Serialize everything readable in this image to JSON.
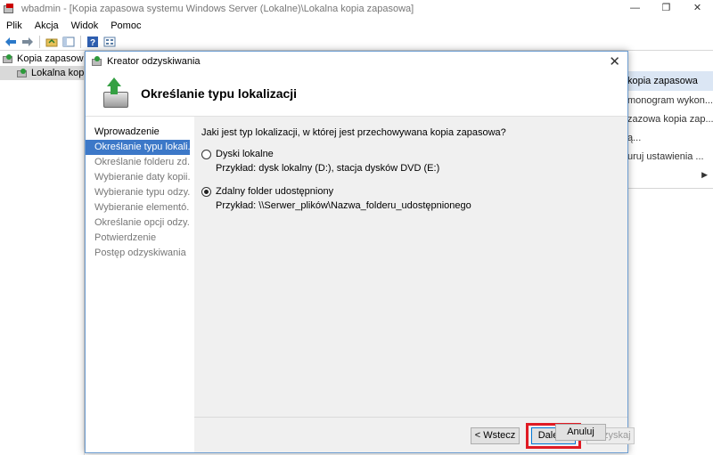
{
  "main_window": {
    "title": "wbadmin - [Kopia zapasowa systemu Windows Server (Lokalne)\\Lokalna kopia zapasowa]",
    "controls": {
      "minimize": "—",
      "maximize": "❐",
      "close": "✕"
    }
  },
  "menu": [
    "Plik",
    "Akcja",
    "Widok",
    "Pomoc"
  ],
  "toolbar": {
    "icons": [
      "back-arrow-icon",
      "forward-arrow-icon",
      "folder-up-icon",
      "console-tree-icon",
      "help-icon",
      "properties-icon"
    ]
  },
  "tree": {
    "items": [
      {
        "label": "Kopia zapasowa sy",
        "selected": false
      },
      {
        "label": "Lokalna kopia",
        "selected": true
      }
    ]
  },
  "actions": {
    "header": "kopia zapasowa",
    "items": [
      "monogram wykon...",
      "zazowa kopia zap...",
      "ą...",
      "uruj ustawienia ..."
    ]
  },
  "wizard": {
    "title": "Kreator odzyskiwania",
    "close": "✕",
    "heading": "Określanie typu lokalizacji",
    "steps": [
      {
        "label": "Wprowadzenie",
        "state": "done"
      },
      {
        "label": "Określanie typu lokali...",
        "state": "active"
      },
      {
        "label": "Określanie folderu zd...",
        "state": "pending"
      },
      {
        "label": "Wybieranie daty kopii...",
        "state": "pending"
      },
      {
        "label": "Wybieranie typu odzy...",
        "state": "pending"
      },
      {
        "label": "Wybieranie elementó...",
        "state": "pending"
      },
      {
        "label": "Określanie opcji odzy...",
        "state": "pending"
      },
      {
        "label": "Potwierdzenie",
        "state": "pending"
      },
      {
        "label": "Postęp odzyskiwania",
        "state": "pending"
      }
    ],
    "question": "Jaki jest typ lokalizacji, w której jest przechowywana kopia zapasowa?",
    "options": [
      {
        "label": "Dyski lokalne",
        "example": "Przykład: dysk lokalny (D:), stacja dysków DVD (E:)",
        "selected": false
      },
      {
        "label": "Zdalny folder udostępniony",
        "example": "Przykład: \\\\Serwer_plików\\Nazwa_folderu_udostępnionego",
        "selected": true
      }
    ],
    "buttons": {
      "back": "< Wstecz",
      "next": "Dalej >",
      "recover": "Odzyskaj",
      "cancel": "Anuluj"
    }
  }
}
